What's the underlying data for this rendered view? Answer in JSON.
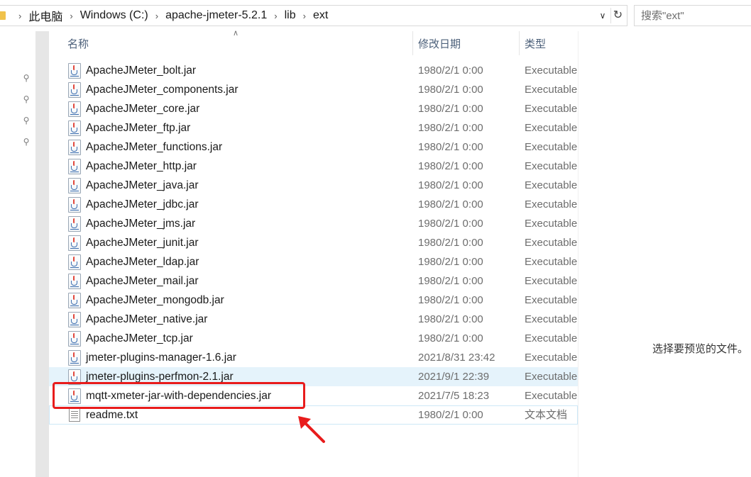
{
  "address_bar": {
    "breadcrumbs": [
      "此电脑",
      "Windows (C:)",
      "apache-jmeter-5.2.1",
      "lib",
      "ext"
    ],
    "dropdown_icon": "chevron-down-icon",
    "refresh_icon": "refresh-icon"
  },
  "search": {
    "placeholder": "搜索\"ext\""
  },
  "columns": {
    "name": "名称",
    "date": "修改日期",
    "type": "类型"
  },
  "files": [
    {
      "name": "ApacheJMeter_bolt.jar",
      "date": "1980/2/1 0:00",
      "type": "Executable",
      "icon": "jar-file-icon"
    },
    {
      "name": "ApacheJMeter_components.jar",
      "date": "1980/2/1 0:00",
      "type": "Executable",
      "icon": "jar-file-icon"
    },
    {
      "name": "ApacheJMeter_core.jar",
      "date": "1980/2/1 0:00",
      "type": "Executable",
      "icon": "jar-file-icon"
    },
    {
      "name": "ApacheJMeter_ftp.jar",
      "date": "1980/2/1 0:00",
      "type": "Executable",
      "icon": "jar-file-icon"
    },
    {
      "name": "ApacheJMeter_functions.jar",
      "date": "1980/2/1 0:00",
      "type": "Executable",
      "icon": "jar-file-icon"
    },
    {
      "name": "ApacheJMeter_http.jar",
      "date": "1980/2/1 0:00",
      "type": "Executable",
      "icon": "jar-file-icon"
    },
    {
      "name": "ApacheJMeter_java.jar",
      "date": "1980/2/1 0:00",
      "type": "Executable",
      "icon": "jar-file-icon"
    },
    {
      "name": "ApacheJMeter_jdbc.jar",
      "date": "1980/2/1 0:00",
      "type": "Executable",
      "icon": "jar-file-icon"
    },
    {
      "name": "ApacheJMeter_jms.jar",
      "date": "1980/2/1 0:00",
      "type": "Executable",
      "icon": "jar-file-icon"
    },
    {
      "name": "ApacheJMeter_junit.jar",
      "date": "1980/2/1 0:00",
      "type": "Executable",
      "icon": "jar-file-icon"
    },
    {
      "name": "ApacheJMeter_ldap.jar",
      "date": "1980/2/1 0:00",
      "type": "Executable",
      "icon": "jar-file-icon"
    },
    {
      "name": "ApacheJMeter_mail.jar",
      "date": "1980/2/1 0:00",
      "type": "Executable",
      "icon": "jar-file-icon"
    },
    {
      "name": "ApacheJMeter_mongodb.jar",
      "date": "1980/2/1 0:00",
      "type": "Executable",
      "icon": "jar-file-icon"
    },
    {
      "name": "ApacheJMeter_native.jar",
      "date": "1980/2/1 0:00",
      "type": "Executable",
      "icon": "jar-file-icon"
    },
    {
      "name": "ApacheJMeter_tcp.jar",
      "date": "1980/2/1 0:00",
      "type": "Executable",
      "icon": "jar-file-icon"
    },
    {
      "name": "jmeter-plugins-manager-1.6.jar",
      "date": "2021/8/31 23:42",
      "type": "Executable",
      "icon": "jar-file-icon"
    },
    {
      "name": "jmeter-plugins-perfmon-2.1.jar",
      "date": "2021/9/1 22:39",
      "type": "Executable",
      "icon": "jar-file-icon"
    },
    {
      "name": "mqtt-xmeter-jar-with-dependencies.jar",
      "date": "2021/7/5 18:23",
      "type": "Executable",
      "icon": "jar-file-icon"
    },
    {
      "name": "readme.txt",
      "date": "1980/2/1 0:00",
      "type": "文本文档",
      "icon": "text-file-icon"
    }
  ],
  "preview": {
    "message": "选择要预览的文件。"
  },
  "colors": {
    "hover_row": "#e5f3fb",
    "annotation_red": "#e81c1c",
    "header_text": "#4c607a"
  }
}
